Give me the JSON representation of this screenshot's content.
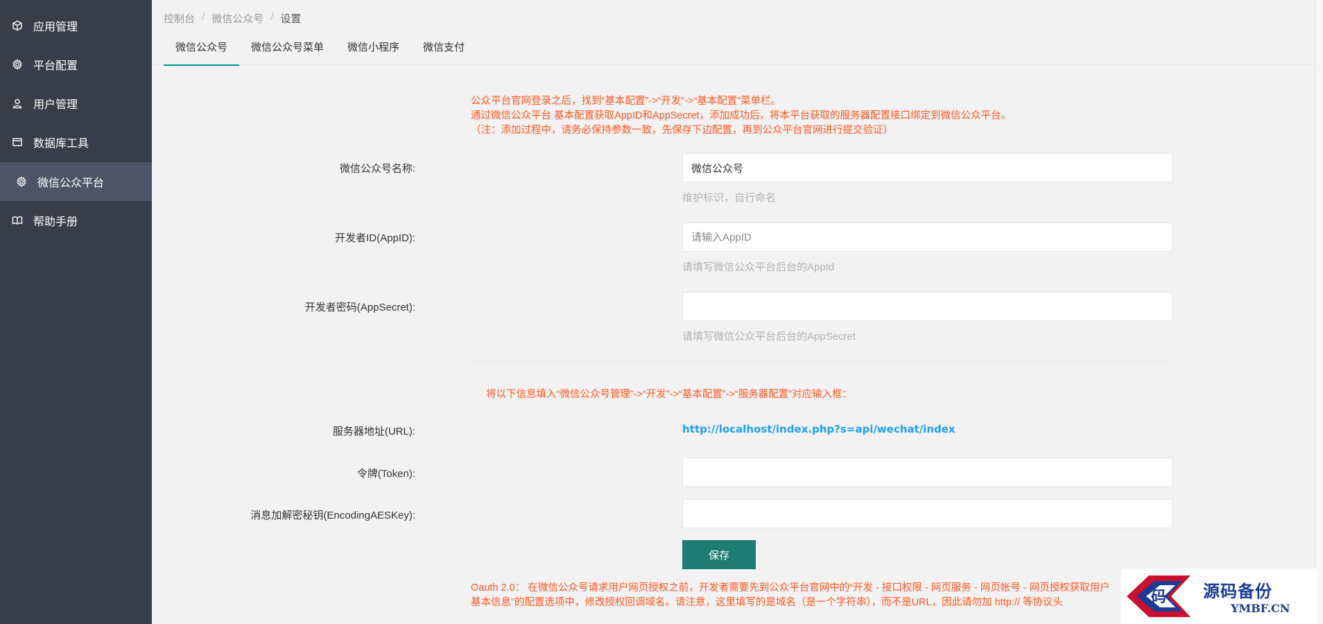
{
  "sidebar": {
    "items": [
      {
        "label": "应用管理",
        "icon": "cube-icon"
      },
      {
        "label": "平台配置",
        "icon": "gear-icon"
      },
      {
        "label": "用户管理",
        "icon": "user-icon"
      },
      {
        "label": "数据库工具",
        "icon": "window-icon"
      },
      {
        "label": "微信公众平台",
        "icon": "gear-icon"
      },
      {
        "label": "帮助手册",
        "icon": "book-icon"
      }
    ],
    "active_index": 4
  },
  "breadcrumb": {
    "items": [
      "控制台",
      "微信公众号",
      "设置"
    ],
    "separator": "/"
  },
  "tabs": [
    {
      "label": "微信公众号"
    },
    {
      "label": "微信公众号菜单"
    },
    {
      "label": "微信小程序"
    },
    {
      "label": "微信支付"
    }
  ],
  "notice": {
    "lines": [
      "公众平台官网登录之后，找到“基本配置”->“开发”->“基本配置”菜单栏。",
      "通过微信公众平台 基本配置获取AppID和AppSecret，添加成功后，将本平台获取的服务器配置接口绑定到微信公众平台。",
      "（注：添加过程中，请务必保持参数一致，先保存下边配置，再到公众平台官网进行提交验证）"
    ]
  },
  "form": {
    "name": {
      "label": "微信公众号名称:",
      "value": "微信公众号",
      "help": "维护标识，自行命名"
    },
    "appid": {
      "label": "开发者ID(AppID):",
      "placeholder": "请输入AppID",
      "value": "",
      "help": "请填写微信公众平台后台的AppId"
    },
    "secret": {
      "label": "开发者密码(AppSecret):",
      "value": "",
      "help": "请填写微信公众平台后台的AppSecret"
    },
    "section_note": "将以下信息填入“微信公众号管理”->“开发”->“基本配置”->“服务器配置”对应输入框：",
    "server_url": {
      "label": "服务器地址(URL):",
      "value": "http://localhost/index.php?s=api/wechat/index"
    },
    "token": {
      "label": "令牌(Token):",
      "value": ""
    },
    "aeskey": {
      "label": "消息加解密秘钥(EncodingAESKey):",
      "value": ""
    },
    "save_label": "保存"
  },
  "oauth": {
    "lines": [
      "Oauth 2.0： 在微信公众号请求用户网页授权之前，开发者需要先到公众平台官网中的“开发 - 接口权限 - 网页服务 - 网页帐号 - 网页授权获取用户",
      "基本信息”的配置选项中，修改授权回调域名。请注意，这里填写的是域名（是一个字符串），而不是URL，因此请勿加 http:// 等协议头"
    ]
  },
  "watermark": {
    "glyph": "码",
    "cn": "源码备份",
    "en": "YMBF.CN"
  },
  "colors": {
    "sidebar_bg": "#393d49",
    "sidebar_active": "#4e5465",
    "accent": "#009688",
    "notice": "#ff5722",
    "link": "#1e9fff",
    "button": "#1e7d73"
  }
}
